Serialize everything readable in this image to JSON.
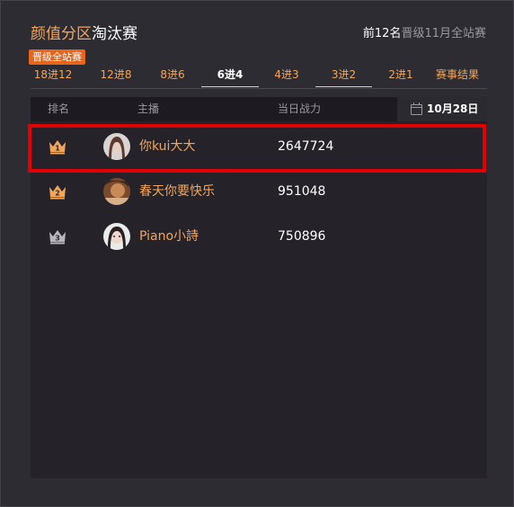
{
  "header": {
    "title_part1": "颜值分区",
    "title_part2": "淘汰赛",
    "right_strong": "前12名",
    "right_rest": "晋级11月全站赛",
    "badge": "晋级全站赛"
  },
  "tabs": [
    {
      "label": "18进12",
      "active": false
    },
    {
      "label": "12进8",
      "active": false
    },
    {
      "label": "8进6",
      "active": false
    },
    {
      "label": "6进4",
      "active": true
    },
    {
      "label": "4进3",
      "active": false
    },
    {
      "label": "3进2",
      "active": false
    },
    {
      "label": "2进1",
      "active": false
    },
    {
      "label": "赛事结果",
      "active": false
    }
  ],
  "table": {
    "headers": {
      "rank": "排名",
      "streamer": "主播",
      "power": "当日战力"
    },
    "date": "10月28日",
    "rows": [
      {
        "rank": "1",
        "name": "你kui大大",
        "power": "2647724",
        "crown_color": "#f2a65a"
      },
      {
        "rank": "2",
        "name": "春天你要快乐",
        "power": "951048",
        "crown_color": "#f2a65a"
      },
      {
        "rank": "3",
        "name": "Piano小詩",
        "power": "750896",
        "crown_color": "#b8b6bc"
      }
    ]
  },
  "colors": {
    "accent": "#f2a65a",
    "highlight": "#e30000",
    "badge": "#e8661c"
  }
}
